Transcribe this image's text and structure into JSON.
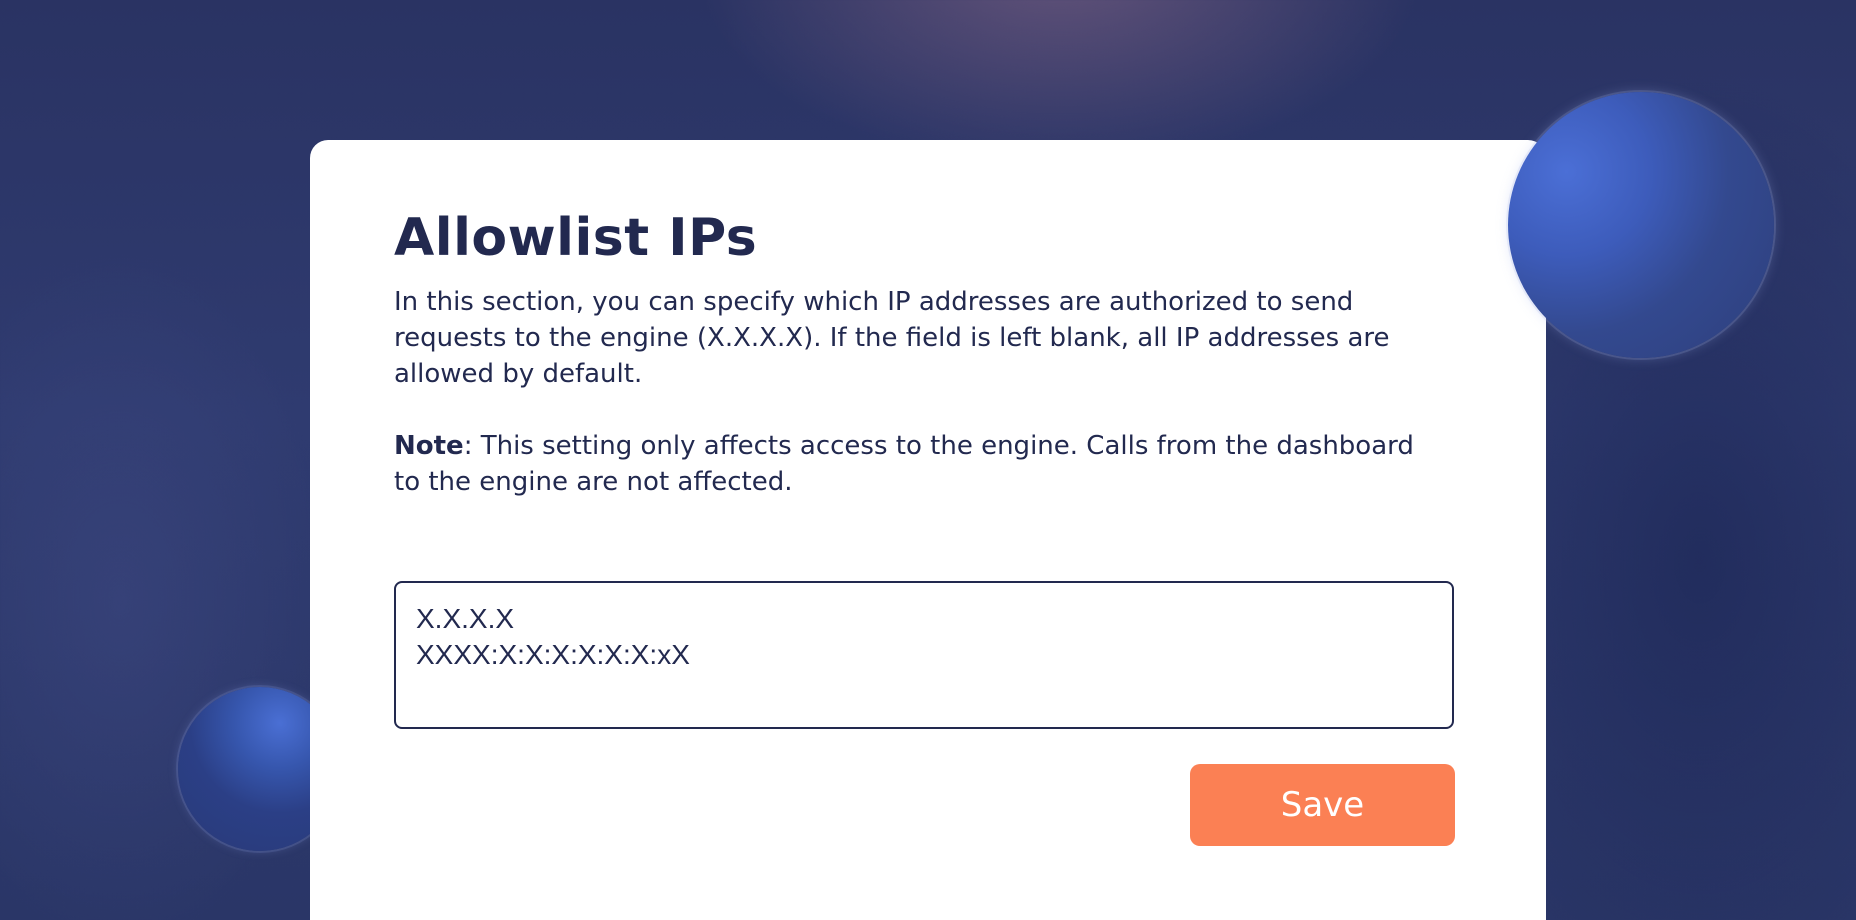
{
  "section": {
    "title": "Allowlist IPs",
    "description": "In this section, you can specify which IP addresses are authorized to send requests to the engine (X.X.X.X). If the field is left blank, all IP addresses are allowed by default.",
    "note_label": "Note",
    "note_text": ": This setting only affects access to the engine. Calls from the dashboard to the engine are not affected."
  },
  "ip_field": {
    "value": "X.X.X.X\nXXXX:X:X:X:X:X:X:xX"
  },
  "actions": {
    "save_label": "Save"
  },
  "colors": {
    "text": "#22294f",
    "accent": "#fb8054",
    "card": "#ffffff",
    "background": "#2f3b70"
  }
}
